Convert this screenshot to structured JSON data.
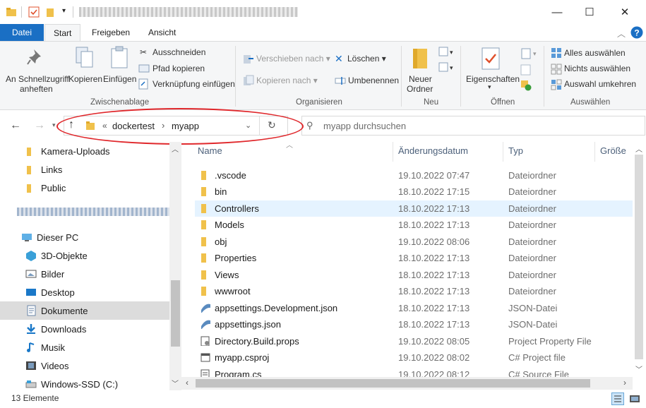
{
  "window": {
    "minimize": "—",
    "maximize": "☐",
    "close": "✕"
  },
  "ribbon_tabs": [
    "Datei",
    "Start",
    "Freigeben",
    "Ansicht"
  ],
  "ribbon": {
    "pin_line1": "An Schnellzugriff",
    "pin_line2": "anheften",
    "copy": "Kopieren",
    "paste": "Einfügen",
    "cut": "Ausschneiden",
    "copy_path": "Pfad kopieren",
    "paste_shortcut": "Verknüpfung einfügen",
    "group_clipboard": "Zwischenablage",
    "move_to": "Verschieben nach",
    "copy_to": "Kopieren nach",
    "delete": "Löschen",
    "rename": "Umbenennen",
    "group_organize": "Organisieren",
    "new_folder_line1": "Neuer",
    "new_folder_line2": "Ordner",
    "group_new": "Neu",
    "properties": "Eigenschaften",
    "group_open": "Öffnen",
    "select_all": "Alles auswählen",
    "select_none": "Nichts auswählen",
    "invert_selection": "Auswahl umkehren",
    "group_select": "Auswählen"
  },
  "address": {
    "overflow": "«",
    "crumb1": "dockertest",
    "sep": "›",
    "crumb2": "myapp",
    "search_placeholder": "myapp durchsuchen"
  },
  "nav": {
    "items": [
      {
        "label": "Kamera-Uploads",
        "icon": "folder-icon"
      },
      {
        "label": "Links",
        "icon": "folder-icon"
      },
      {
        "label": "Public",
        "icon": "folder-icon"
      },
      {
        "label": "Dieser PC",
        "icon": "pc-icon"
      },
      {
        "label": "3D-Objekte",
        "icon": "cube-icon"
      },
      {
        "label": "Bilder",
        "icon": "pictures-icon"
      },
      {
        "label": "Desktop",
        "icon": "desktop-icon"
      },
      {
        "label": "Dokumente",
        "icon": "documents-icon"
      },
      {
        "label": "Downloads",
        "icon": "download-icon"
      },
      {
        "label": "Musik",
        "icon": "music-icon"
      },
      {
        "label": "Videos",
        "icon": "video-icon"
      },
      {
        "label": "Windows-SSD (C:)",
        "icon": "drive-icon"
      }
    ]
  },
  "columns": [
    "Name",
    "Änderungsdatum",
    "Typ",
    "Größe"
  ],
  "files": [
    {
      "name": ".vscode",
      "date": "19.10.2022 07:47",
      "type": "Dateiordner",
      "icon": "folder-icon"
    },
    {
      "name": "bin",
      "date": "18.10.2022 17:15",
      "type": "Dateiordner",
      "icon": "folder-icon"
    },
    {
      "name": "Controllers",
      "date": "18.10.2022 17:13",
      "type": "Dateiordner",
      "icon": "folder-icon"
    },
    {
      "name": "Models",
      "date": "18.10.2022 17:13",
      "type": "Dateiordner",
      "icon": "folder-icon"
    },
    {
      "name": "obj",
      "date": "19.10.2022 08:06",
      "type": "Dateiordner",
      "icon": "folder-icon"
    },
    {
      "name": "Properties",
      "date": "18.10.2022 17:13",
      "type": "Dateiordner",
      "icon": "folder-icon"
    },
    {
      "name": "Views",
      "date": "18.10.2022 17:13",
      "type": "Dateiordner",
      "icon": "folder-icon"
    },
    {
      "name": "wwwroot",
      "date": "18.10.2022 17:13",
      "type": "Dateiordner",
      "icon": "folder-icon"
    },
    {
      "name": "appsettings.Development.json",
      "date": "18.10.2022 17:13",
      "type": "JSON-Datei",
      "icon": "json-file-icon"
    },
    {
      "name": "appsettings.json",
      "date": "18.10.2022 17:13",
      "type": "JSON-Datei",
      "icon": "json-file-icon"
    },
    {
      "name": "Directory.Build.props",
      "date": "19.10.2022 08:05",
      "type": "Project Property File",
      "icon": "props-file-icon"
    },
    {
      "name": "myapp.csproj",
      "date": "19.10.2022 08:02",
      "type": "C# Project file",
      "icon": "csproj-file-icon"
    },
    {
      "name": "Program.cs",
      "date": "19.10.2022 08:12",
      "type": "C# Source File",
      "icon": "cs-file-icon"
    }
  ],
  "status": {
    "count": "13 Elemente"
  },
  "colors": {
    "accent": "#1a6fc4",
    "folder": "#f0c14b",
    "selection": "#e5f3ff",
    "annotation_oval": "#e0282c"
  }
}
